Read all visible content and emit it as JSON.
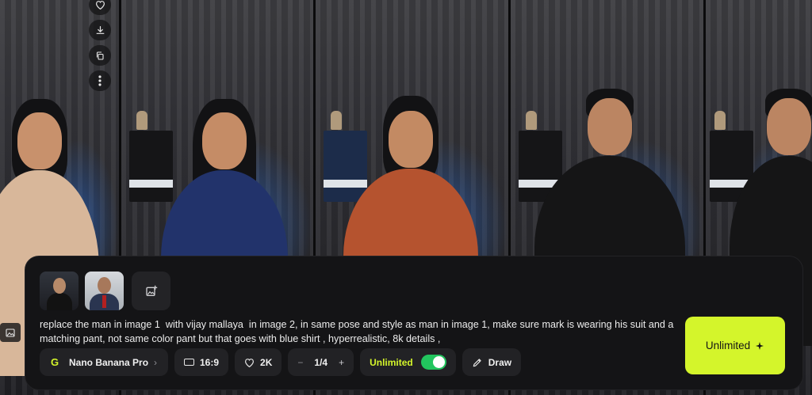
{
  "gallery": {
    "actions": [
      {
        "icon": "heart-icon"
      },
      {
        "icon": "download-icon"
      },
      {
        "icon": "copy-icon"
      },
      {
        "icon": "more-icon"
      }
    ]
  },
  "prompt": {
    "reference_images": [
      {
        "name": "reference-image-1"
      },
      {
        "name": "reference-image-2"
      }
    ],
    "add_image_icon": "add-image-icon",
    "text": "replace the man in image 1  with vijay mallaya  in image 2, in same pose and style as man in image 1, make sure mark is wearing his suit and a matching pant, not same color pant but that goes with blue shirt , hyperrealistic, 8k details ,"
  },
  "toolbar": {
    "model": {
      "logo": "G",
      "label": "Nano Banana Pro",
      "chevron": "›"
    },
    "aspect": {
      "label": "16:9"
    },
    "quality": {
      "label": "2K"
    },
    "count": {
      "minus": "−",
      "label": "1/4",
      "plus": "+"
    },
    "unlimited": {
      "label": "Unlimited",
      "enabled": true
    },
    "draw": {
      "label": "Draw"
    }
  },
  "generate_button": {
    "label": "Unlimited",
    "icon": "sparkle-icon"
  },
  "colors": {
    "accent": "#d4f52b",
    "toggle_on": "#22c55e",
    "panel": "#141416"
  }
}
